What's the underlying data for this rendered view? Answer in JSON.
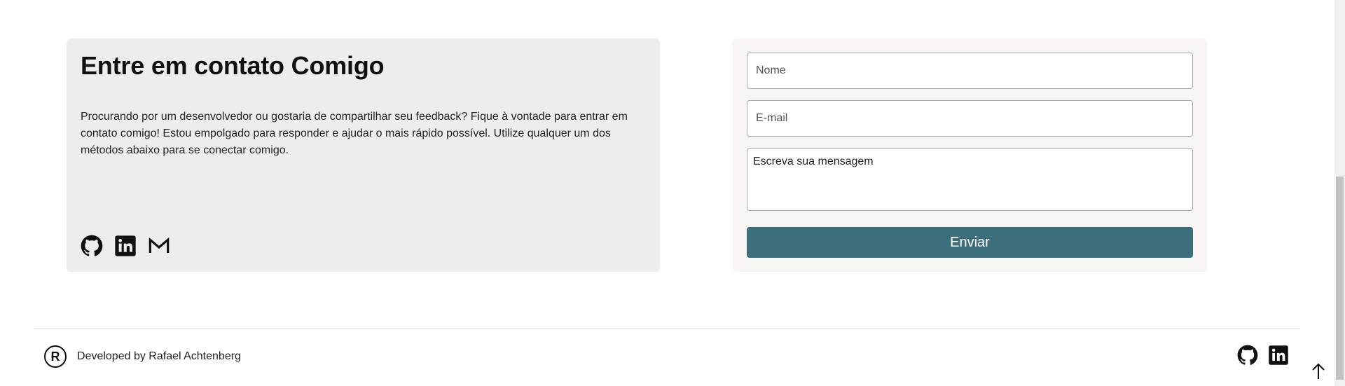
{
  "contact": {
    "title": "Entre em contato Comigo",
    "description": "Procurando por um desenvolvedor ou gostaria de compartilhar seu feedback? Fique à vontade para entrar em contato comigo! Estou empolgado para responder e ajudar o mais rápido possível. Utilize qualquer um dos métodos abaixo para se conectar comigo.",
    "icons": [
      "github-icon",
      "linkedin-icon",
      "gmail-icon"
    ]
  },
  "form": {
    "name_placeholder": "Nome",
    "email_placeholder": "E-mail",
    "message_placeholder": "Escreva sua mensagem",
    "submit_label": "Enviar"
  },
  "footer": {
    "logo_letter": "R",
    "credit": "Developed by Rafael Achtenberg",
    "icons": [
      "github-icon",
      "linkedin-icon"
    ],
    "back_to_top_icon": "arrow-up-icon"
  },
  "colors": {
    "accent": "#3d6e7c",
    "contact_card_bg": "#ededed",
    "form_card_bg": "#f8f4f3"
  }
}
